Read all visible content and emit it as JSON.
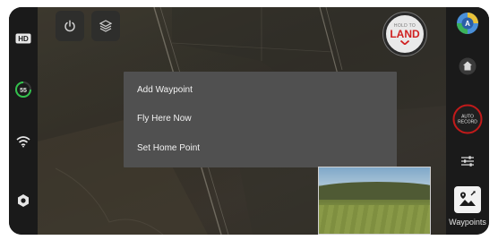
{
  "menu": {
    "items": [
      {
        "label": "Add Waypoint"
      },
      {
        "label": "Fly Here Now"
      },
      {
        "label": "Set Home Point"
      }
    ]
  },
  "land_button": {
    "line1": "HOLD TO",
    "line2": "LAND"
  },
  "left_bar": {
    "hd_label": "HD",
    "battery_value": "55",
    "battery_color": "#33c24d"
  },
  "right_bar": {
    "avatar_initial": "A",
    "auto_record_line1": "AUTO",
    "auto_record_line2": "RECORD",
    "waypoints_label": "Waypoints"
  },
  "colors": {
    "land_red": "#d02020",
    "record_red": "#c21a1a",
    "menu_bg": "#505050"
  },
  "icons": [
    "hd-icon",
    "battery-icon",
    "wifi-icon",
    "settings-hex-icon",
    "power-icon",
    "layers-icon",
    "home-icon",
    "sliders-icon",
    "waypoints-map-icon",
    "avatar-icon"
  ]
}
